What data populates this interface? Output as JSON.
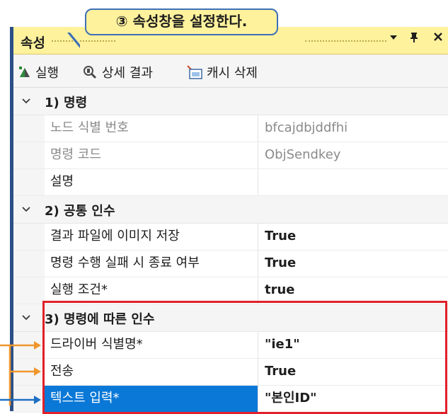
{
  "callout": {
    "text": "③ 속성창을 설정한다."
  },
  "panel": {
    "title": "속성",
    "controls": {
      "dropdown": "▾",
      "pin": "ᅟ",
      "close": "✕"
    }
  },
  "toolbar": {
    "run_label": "실행",
    "details_label": "상세 결과",
    "clear_cache_label": "캐시 삭제"
  },
  "sections": [
    {
      "label": "1) 명령",
      "rows": [
        {
          "name": "노드 식별 번호",
          "value": "bfcajdbjddfhi"
        },
        {
          "name": "명령 코드",
          "value": "ObjSendkey"
        },
        {
          "name": "설명",
          "value": ""
        }
      ]
    },
    {
      "label": "2) 공통 인수",
      "rows": [
        {
          "name": "결과 파일에 이미지 저장",
          "value": "True"
        },
        {
          "name": "명령 수행 실패 시 종료 여부",
          "value": "True"
        },
        {
          "name": "실행 조건*",
          "value": "true"
        }
      ]
    },
    {
      "label": "3) 명령에 따른 인수",
      "rows": [
        {
          "name": "드라이버 식별명*",
          "value": "\"ie1\""
        },
        {
          "name": "전송",
          "value": "True"
        },
        {
          "name": "텍스트 입력*",
          "value": "\"본인ID\""
        }
      ]
    }
  ],
  "colors": {
    "title_bg": "#fff29d",
    "selection": "#0a78d7",
    "highlight_box": "#e0202a",
    "arrow_orange": "#f0962d",
    "arrow_blue": "#1f6fc4"
  }
}
